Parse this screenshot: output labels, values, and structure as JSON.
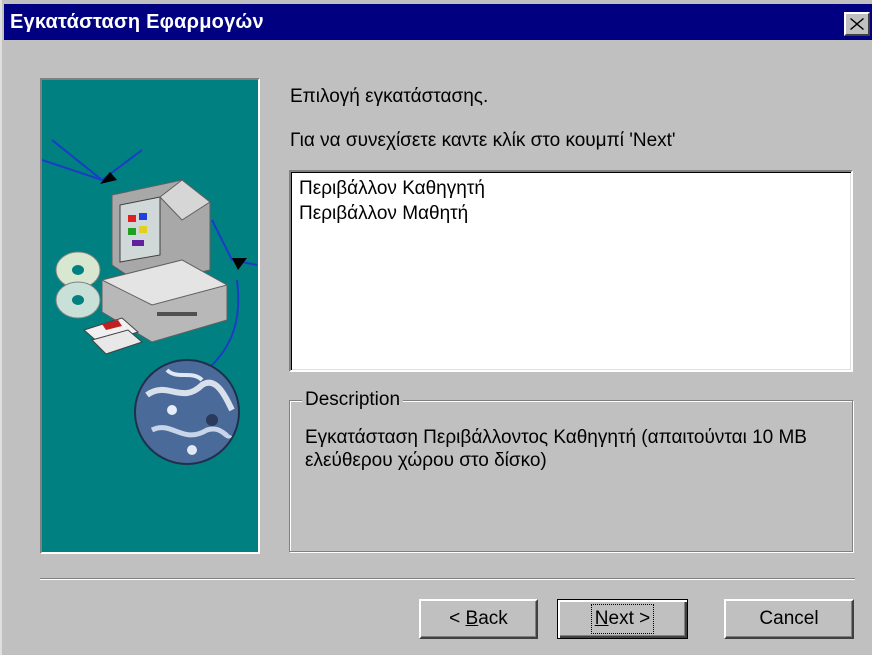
{
  "window": {
    "title": "Εγκατάσταση Εφαρμογών"
  },
  "content": {
    "heading": "Επιλογή εγκατάστασης.",
    "instruction": "Για να συνεχίσετε καντε κλίκ στο κουμπί 'Next'"
  },
  "options": [
    {
      "label": "Περιβάλλον Καθηγητή"
    },
    {
      "label": "Περιβάλλον Μαθητή"
    }
  ],
  "description": {
    "legend": "Description",
    "text": "Εγκατάσταση Περιβάλλοντος Καθηγητή    (απαιτούνται 10 MB ελεύθερου χώρου στο δίσκο)"
  },
  "buttons": {
    "back": {
      "prefix": "< ",
      "mnemonic": "B",
      "rest": "ack"
    },
    "next": {
      "mnemonic": "N",
      "rest": "ext >"
    },
    "cancel": "Cancel"
  },
  "colors": {
    "titlebar": "#000080",
    "dialog": "#c0c0c0",
    "panel": "#008080"
  },
  "icons": [
    "close-icon",
    "computer-illustration-icon",
    "cd-icon",
    "floppy-disk-icon",
    "globe-icon"
  ]
}
